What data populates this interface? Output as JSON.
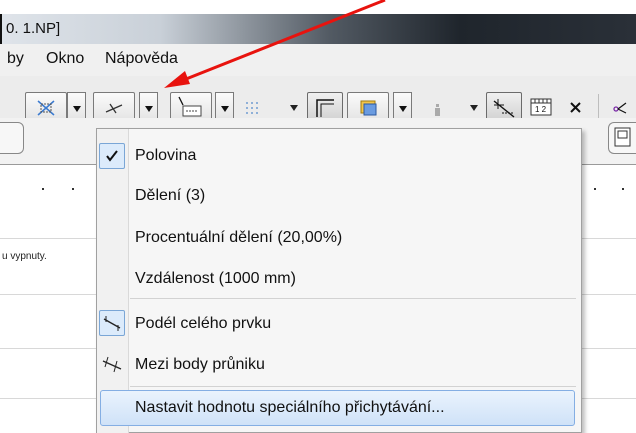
{
  "window": {
    "title": "0. 1.NP]"
  },
  "menu": {
    "items": [
      {
        "label": "by"
      },
      {
        "label": "Okno"
      },
      {
        "label": "Nápověda"
      }
    ]
  },
  "side_note": "u vypnuty.",
  "toolbar": {
    "buttons": [
      {
        "icon": "snap-points-icon"
      },
      {
        "icon": "special-snap-icon"
      },
      {
        "icon": "snap-grid-icon"
      },
      {
        "icon": "grid-points-icon"
      },
      {
        "icon": "corner-snap-icon"
      },
      {
        "icon": "layer-box-icon"
      },
      {
        "icon": "figure-icon"
      },
      {
        "icon": "measure-icon"
      },
      {
        "icon": "ruler-icon"
      },
      {
        "icon": "cross-icon"
      },
      {
        "icon": "trace-icon"
      }
    ],
    "ruler_icon_text": "1 2"
  },
  "dropdown": {
    "items": [
      {
        "label": "Polovina",
        "checked": true
      },
      {
        "label": "Dělení (3)"
      },
      {
        "label": "Procentuální dělení (20,00%)"
      },
      {
        "label": "Vzdálenost (1000 mm)"
      },
      {
        "label": "Podél celého prvku",
        "icon": "along-element-icon",
        "selected": true
      },
      {
        "label": "Mezi body průniku",
        "icon": "between-intersections-icon"
      },
      {
        "label": "Nastavit hodnotu speciálního přichytávání...",
        "highlighted": true
      }
    ]
  },
  "annotation": {
    "arrow_color": "#e8130e"
  },
  "colors": {
    "highlight": "#cfe2f8",
    "highlight_border": "#84aee3",
    "selected_icon_bg": "#dcebfb"
  }
}
